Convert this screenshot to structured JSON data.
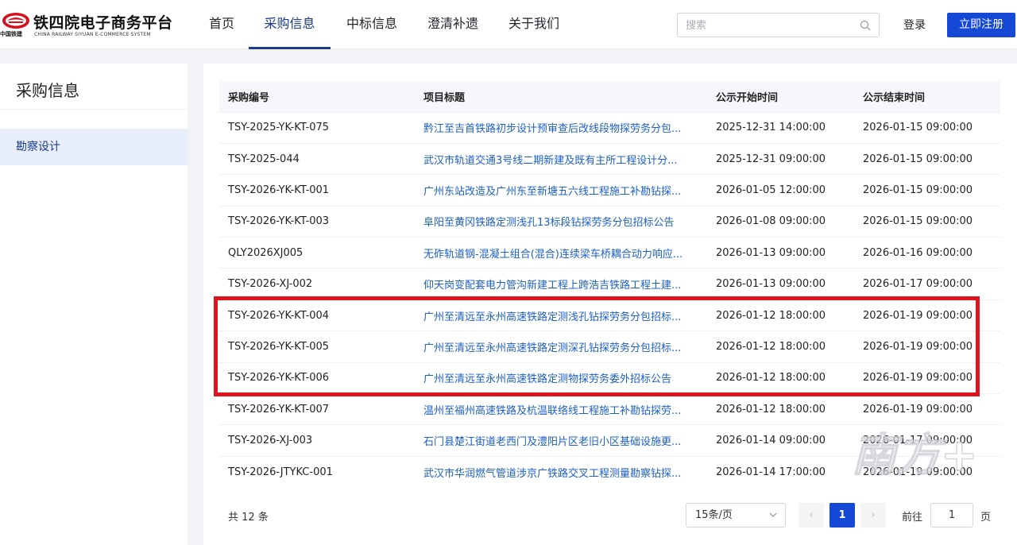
{
  "brand": {
    "title": "铁四院电子商务平台",
    "mark_text": "中国铁建",
    "english": "CHINA  RAILWAY  SIYUAN  E-COMMERCE SYSTEM"
  },
  "nav": {
    "items": [
      {
        "label": "首页"
      },
      {
        "label": "采购信息"
      },
      {
        "label": "中标信息"
      },
      {
        "label": "澄清补遗"
      },
      {
        "label": "关于我们"
      }
    ],
    "active_index": 1
  },
  "search": {
    "placeholder": "搜索",
    "value": ""
  },
  "auth": {
    "login_label": "登录",
    "register_label": "立即注册"
  },
  "sidebar": {
    "title": "采购信息",
    "items": [
      {
        "label": "勘察设计"
      }
    ]
  },
  "table": {
    "columns": [
      "采购编号",
      "项目标题",
      "公示开始时间",
      "公示结束时间"
    ],
    "rows": [
      {
        "code": "TSY-2025-YK-KT-075",
        "title": "黔江至吉首铁路初步设计预审查后改线段物探劳务分包...",
        "start": "2025-12-31 14:00:00",
        "end": "2026-01-15 09:00:00"
      },
      {
        "code": "TSY-2025-044",
        "title": "武汉市轨道交通3号线二期新建及既有主所工程设计分...",
        "start": "2025-12-31 09:00:00",
        "end": "2026-01-15 09:00:00"
      },
      {
        "code": "TSY-2026-YK-KT-001",
        "title": "广州东站改造及广州东至新塘五六线工程施工补勘钻探...",
        "start": "2026-01-05 12:00:00",
        "end": "2026-01-15 09:00:00"
      },
      {
        "code": "TSY-2026-YK-KT-003",
        "title": "阜阳至黄冈铁路定测浅孔13标段钻探劳务分包招标公告",
        "start": "2026-01-08 09:00:00",
        "end": "2026-01-15 09:00:00"
      },
      {
        "code": "QLY2026XJ005",
        "title": "无砟轨道钢-混凝土组合(混合)连续梁车桥耦合动力响应...",
        "start": "2026-01-13 09:00:00",
        "end": "2026-01-16 09:00:00"
      },
      {
        "code": "TSY-2026-XJ-002",
        "title": "仰天岗变配套电力管沟新建工程上跨浩吉铁路工程土建...",
        "start": "2026-01-13 09:00:00",
        "end": "2026-01-17 09:00:00"
      },
      {
        "code": "TSY-2026-YK-KT-004",
        "title": "广州至清远至永州高速铁路定测浅孔钻探劳务分包招标...",
        "start": "2026-01-12 18:00:00",
        "end": "2026-01-19 09:00:00"
      },
      {
        "code": "TSY-2026-YK-KT-005",
        "title": "广州至清远至永州高速铁路定测深孔钻探劳务分包招标...",
        "start": "2026-01-12 18:00:00",
        "end": "2026-01-19 09:00:00"
      },
      {
        "code": "TSY-2026-YK-KT-006",
        "title": "广州至清远至永州高速铁路定测物探劳务委外招标公告",
        "start": "2026-01-12 18:00:00",
        "end": "2026-01-19 09:00:00"
      },
      {
        "code": "TSY-2026-YK-KT-007",
        "title": "温州至福州高速铁路及杭温联络线工程施工补勘钻探劳...",
        "start": "2026-01-12 18:00:00",
        "end": "2026-01-19 09:00:00"
      },
      {
        "code": "TSY-2026-XJ-003",
        "title": "石门县楚江街道老西门及澧阳片区老旧小区基础设施更...",
        "start": "2026-01-14 09:00:00",
        "end": "2026-01-17 09:00:00"
      },
      {
        "code": "TSY-2026-JTYKC-001",
        "title": "武汉市华润燃气管道涉京广铁路交叉工程测量勘察钻探...",
        "start": "2026-01-14 17:00:00",
        "end": "2026-01-19 09:00:00"
      }
    ]
  },
  "pagination": {
    "total_label": "共 12 条",
    "page_size_label": "15条/页",
    "prev_glyph": "‹",
    "current_page": "1",
    "next_glyph": "›",
    "goto_label": "前往",
    "goto_value": "1",
    "goto_suffix": "页"
  },
  "colors": {
    "accent": "#1648d6",
    "nav_active": "#1b3a8c",
    "link": "#1d5fc4",
    "highlight_box": "#e0141e"
  },
  "watermark": {
    "text": "南方+"
  }
}
